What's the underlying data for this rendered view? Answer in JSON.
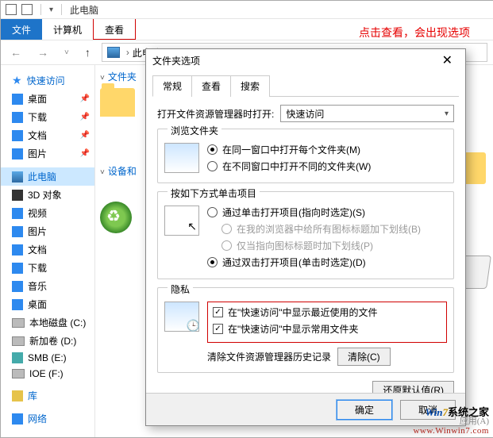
{
  "window": {
    "title": "此电脑"
  },
  "ribbon": {
    "file": "文件",
    "computer": "计算机",
    "view": "查看"
  },
  "breadcrumb": {
    "location": "此电脑"
  },
  "annotation": "点击查看，会出现选项",
  "sidebar": {
    "quick_access": "快速访问",
    "items_qa": [
      {
        "label": "桌面",
        "icon": "desktop"
      },
      {
        "label": "下载",
        "icon": "download"
      },
      {
        "label": "文档",
        "icon": "document"
      },
      {
        "label": "图片",
        "icon": "picture"
      }
    ],
    "this_pc": "此电脑",
    "items_pc": [
      {
        "label": "3D 对象"
      },
      {
        "label": "视频"
      },
      {
        "label": "图片"
      },
      {
        "label": "文档"
      },
      {
        "label": "下载"
      },
      {
        "label": "音乐"
      },
      {
        "label": "桌面"
      },
      {
        "label": "本地磁盘 (C:)"
      },
      {
        "label": "新加卷 (D:)"
      },
      {
        "label": "SMB (E:)"
      },
      {
        "label": "IOE (F:)"
      }
    ],
    "libraries": "库",
    "network": "网络"
  },
  "main": {
    "group_folders": "文件夹",
    "group_devices": "设备和"
  },
  "dialog": {
    "title": "文件夹选项",
    "tabs": {
      "general": "常规",
      "view": "查看",
      "search": "搜索"
    },
    "open_label": "打开文件资源管理器时打开:",
    "open_value": "快速访问",
    "browse": {
      "legend": "浏览文件夹",
      "same": "在同一窗口中打开每个文件夹(M)",
      "new": "在不同窗口中打开不同的文件夹(W)"
    },
    "click": {
      "legend": "按如下方式单击项目",
      "single": "通过单击打开项目(指向时选定)(S)",
      "underline_all": "在我的浏览器中给所有图标标题加下划线(B)",
      "underline_point": "仅当指向图标标题时加下划线(P)",
      "double": "通过双击打开项目(单击时选定)(D)"
    },
    "privacy": {
      "legend": "隐私",
      "recent": "在\"快速访问\"中显示最近使用的文件",
      "frequent": "在\"快速访问\"中显示常用文件夹",
      "clear_label": "清除文件资源管理器历史记录",
      "clear_btn": "清除(C)"
    },
    "restore": "还原默认值(R)",
    "ok": "确定",
    "cancel": "取消",
    "apply": "应用"
  },
  "brand": {
    "win": "Win",
    "seven": "7",
    "cn": "系统之家",
    "url": "www.Winwin7.com",
    "sub": "应用(A)"
  }
}
